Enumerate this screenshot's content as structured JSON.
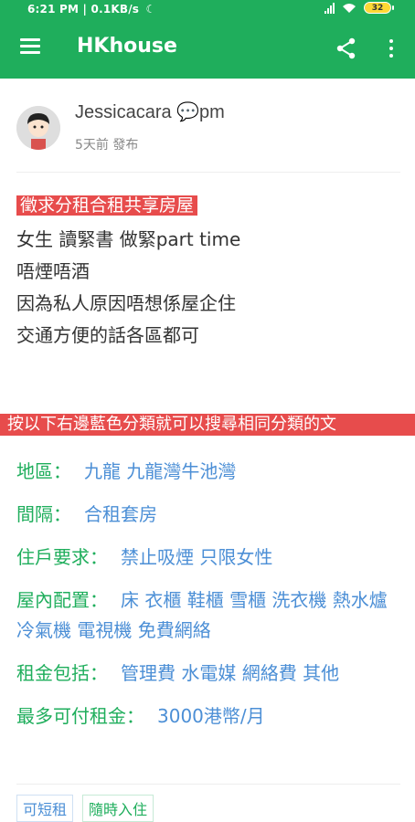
{
  "status_bar": {
    "time": "6:21 PM",
    "speed": "0.1KB/s",
    "battery": "32"
  },
  "app_bar": {
    "title": "HKhouse"
  },
  "author": {
    "name": "Jessicacara 💬pm",
    "posted": "5天前 發布"
  },
  "post": {
    "tag": "徵求分租合租共享房屋",
    "lines": [
      "女生 讀緊書 做緊part time",
      "唔煙唔酒",
      "因為私人原因唔想係屋企住",
      "交通方便的話各區都可"
    ]
  },
  "hint": "按以下右邊藍色分類就可以搜尋相同分類的文",
  "details": [
    {
      "label": "地區：",
      "value": "九龍 九龍灣牛池灣"
    },
    {
      "label": "間隔：",
      "value": "合租套房"
    },
    {
      "label": "住戶要求：",
      "value": "禁止吸煙 只限女性"
    },
    {
      "label": "屋內配置：",
      "value": "床 衣櫃 鞋櫃 雪櫃 洗衣機 熱水爐 冷氣機 電視機 免費網絡"
    },
    {
      "label": "租金包括：",
      "value": "管理費 水電媒 網絡費 其他"
    },
    {
      "label": "最多可付租金：",
      "value": "3000港幣/月"
    }
  ],
  "chips": [
    "可短租",
    "隨時入住"
  ],
  "colors": {
    "brand_green": "#1fae5c",
    "accent_red": "#e74c4c",
    "link_blue": "#4c8fd6"
  }
}
